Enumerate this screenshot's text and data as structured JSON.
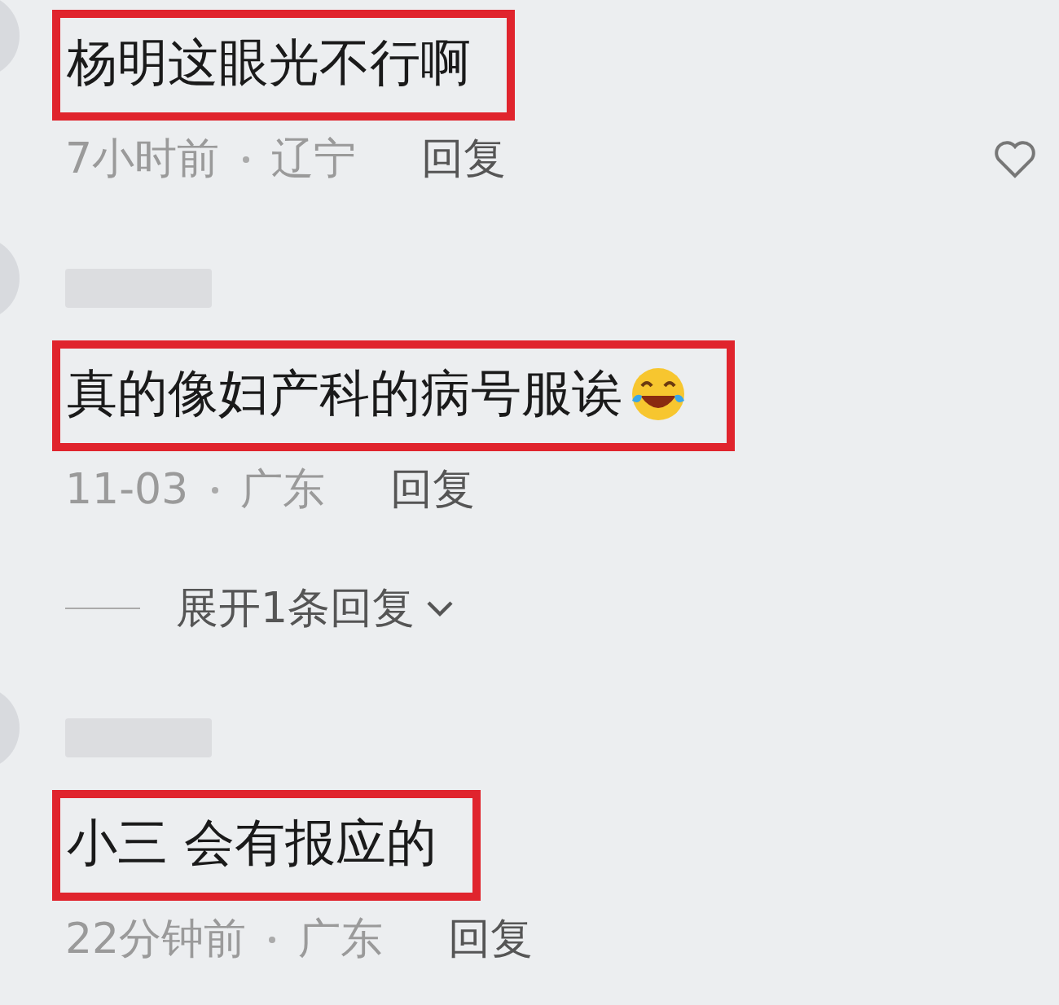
{
  "comments": [
    {
      "username_hidden": false,
      "text": "杨明这眼光不行啊",
      "laughing_emoji": false,
      "time": "7小时前",
      "location": "辽宁",
      "reply": "回复",
      "like_icon": true
    },
    {
      "username_hidden": true,
      "text": "真的像妇产科的病号服诶",
      "laughing_emoji": true,
      "time": "11-03",
      "location": "广东",
      "reply": "回复",
      "like_icon": false,
      "more_replies": "展开1条回复"
    },
    {
      "username_hidden": true,
      "text": "小三 会有报应的",
      "laughing_emoji": false,
      "time": "22分钟前",
      "location": "广东",
      "reply": "回复",
      "like_icon": false
    }
  ]
}
